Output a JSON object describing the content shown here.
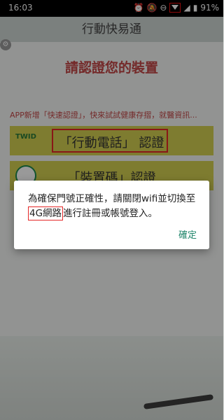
{
  "status": {
    "time": "16:03",
    "battery": "91%"
  },
  "app": {
    "title": "行動快易通"
  },
  "main": {
    "headline": "請認證您的裝置",
    "banner": "APP新增「快速認證」，快來試試健康存摺，就醫資訊...",
    "cards": [
      {
        "title": "「行動電話」 認證",
        "logo_text": "TWID"
      },
      {
        "title": "「裝置碼」認證"
      }
    ]
  },
  "dialog": {
    "message_before": "為確保門號正確性，請關閉wifi並切換至",
    "message_highlight": "4G網路",
    "message_after": "進行註冊或帳號登入。",
    "ok_label": "確定"
  }
}
